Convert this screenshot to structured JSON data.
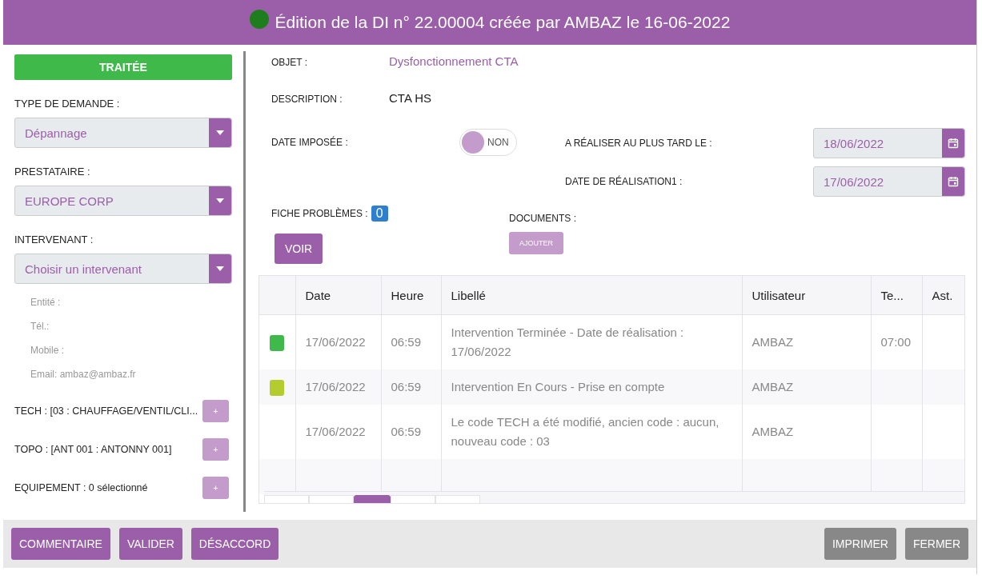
{
  "header": {
    "status_on": true,
    "title": "Édition de la DI n° 22.00004 créée par AMBAZ le 16-06-2022"
  },
  "sidebar": {
    "status": "TRAITÉE",
    "selects": [
      {
        "label": "TYPE DE DEMANDE :",
        "value": "Dépannage"
      },
      {
        "label": "PRESTATAIRE :",
        "value": "EUROPE CORP"
      },
      {
        "label": "INTERVENANT :",
        "value": "Choisir un intervenant"
      }
    ],
    "contact": [
      "Entité :",
      "Tél.:",
      "Mobile :",
      "Email: ambaz@ambaz.fr"
    ],
    "assignments": [
      {
        "label": "TECH : [03 : CHAUFFAGE/VENTIL/CLI...",
        "button": "+"
      },
      {
        "label": "TOPO : [ANT 001 : ANTONNY 001]",
        "button": "+"
      },
      {
        "label": "EQUIPEMENT : 0 sélectionné",
        "button": "+"
      }
    ]
  },
  "details": {
    "objet_label": "OBJET :",
    "objet": "Dysfonctionnement CTA",
    "description_label": "DESCRIPTION :",
    "description": "CTA HS",
    "date_imposee": {
      "label": "DATE IMPOSÉE :",
      "on": false,
      "text": "NON"
    },
    "dates": [
      {
        "label": "A RÉALISER AU PLUS TARD LE :",
        "value": "18/06/2022"
      },
      {
        "label": "DATE DE RÉALISATION1 :",
        "value": "17/06/2022"
      }
    ],
    "fiche_label": "FICHE PROBLÈMES :",
    "fiche_count": "0",
    "voir": "VOIR",
    "documents_label": "DOCUMENTS :",
    "ajouter": "AJOUTER"
  },
  "table": {
    "columns": [
      "Date",
      "Heure",
      "Libellé",
      "Utilisateur",
      "Te...",
      "Ast."
    ],
    "rows": [
      {
        "color": "#3fb94a",
        "cells": [
          "17/06/2022",
          "06:59",
          "Intervention Terminée - Date de réalisation : 17/06/2022",
          "AMBAZ",
          "07:00",
          ""
        ]
      },
      {
        "color": "#b5cc2e",
        "cells": [
          "17/06/2022",
          "06:59",
          "Intervention En Cours - Prise en compte",
          "AMBAZ",
          "",
          ""
        ]
      },
      {
        "cells": [
          "17/06/2022",
          "06:59",
          "Le code TECH a été modifié, ancien code : aucun, nouveau code : 03",
          "AMBAZ",
          "",
          ""
        ]
      },
      {
        "cells": [
          "",
          "",
          "",
          "",
          "",
          ""
        ]
      }
    ],
    "pages": [
      {
        "selected": false
      },
      {
        "selected": false
      },
      {
        "selected": true
      },
      {
        "selected": false
      },
      {
        "selected": false
      }
    ]
  },
  "footer": {
    "left": [
      "COMMENTAIRE",
      "VALIDER",
      "DÉSACCORD"
    ],
    "right": [
      "IMPRIMER",
      "FERMER"
    ]
  }
}
